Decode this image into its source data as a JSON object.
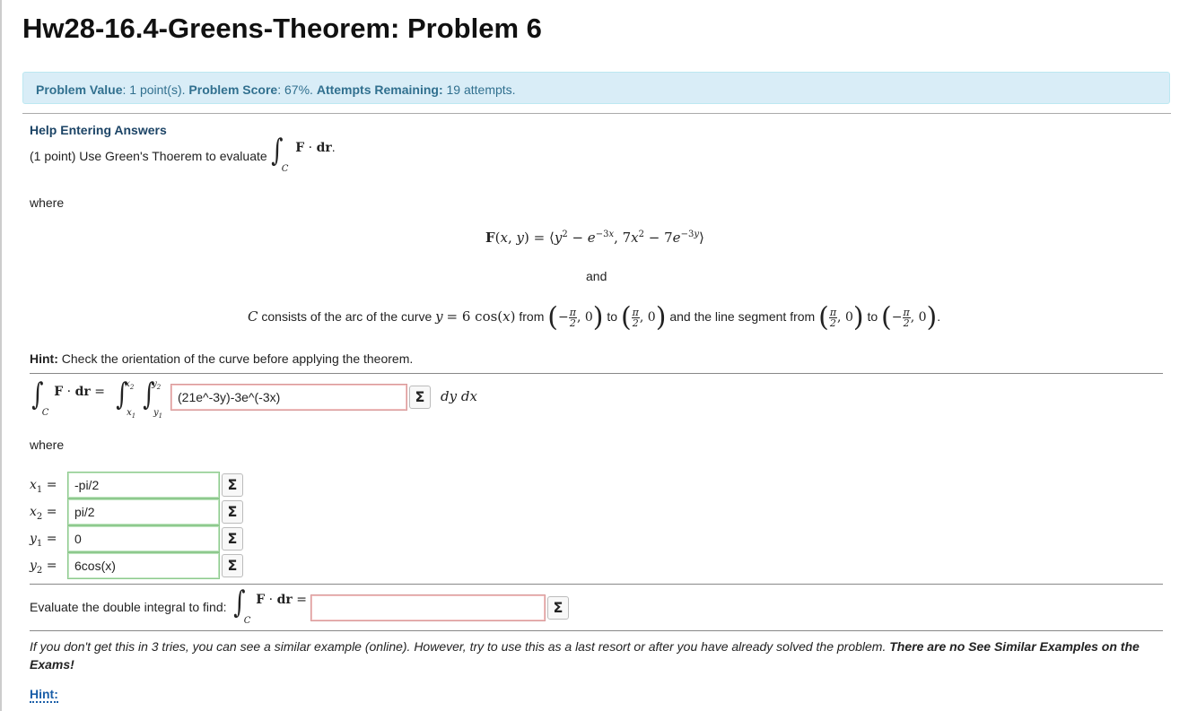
{
  "page_title": "Hw28-16.4-Greens-Theorem: Problem 6",
  "status": {
    "value_label": "Problem Value",
    "value_text": ": 1 point(s). ",
    "score_label": "Problem Score",
    "score_text": ": 67%. ",
    "attempts_label": "Attempts Remaining:",
    "attempts_text": " 19 attempts."
  },
  "help_link": "Help Entering Answers",
  "problem": {
    "intro": "(1 point) Use Green's Thoerem to evaluate",
    "where": "where",
    "and": "and",
    "curve_intro": "consists of the arc of the curve",
    "from1": "from",
    "to1": "to",
    "segment": "and the line segment from",
    "to2": "to",
    "hint_line_label": "Hint:",
    "hint_line_text": " Check the orientation of the curve before applying the theorem.",
    "where2": "where",
    "evaluate_text": "Evaluate the double integral to find:",
    "similar_note": "If you don't get this in 3 tries, you can see a similar example (online). However, try to use this as a last resort or after you have already solved the problem.",
    "similar_note_bold": "There are no See Similar Examples on the Exams!",
    "hint_link": "Hint:"
  },
  "answers": {
    "integrand": "(21e^-3y)-3e^(-3x)",
    "x1": "-pi/2",
    "x2": "pi/2",
    "y1": "0",
    "y2": "6cos(x)",
    "final": ""
  },
  "sigma_label": "Σ"
}
